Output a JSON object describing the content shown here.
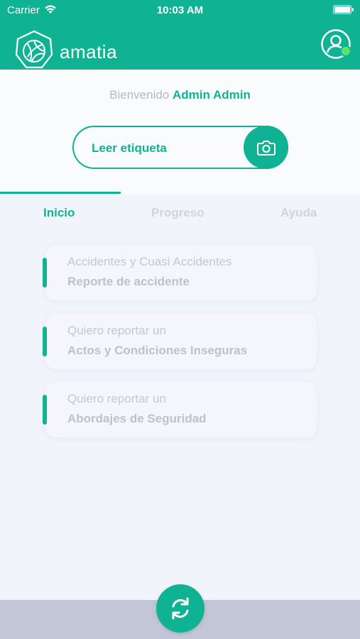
{
  "status_bar": {
    "carrier": "Carrier",
    "time": "10:03 AM"
  },
  "header": {
    "brand": "amatia"
  },
  "welcome": {
    "greeting": "Bienvenido",
    "user": "Admin Admin"
  },
  "scan": {
    "label": "Leer etiqueta"
  },
  "tabs": [
    {
      "label": "Inicio",
      "active": true
    },
    {
      "label": "Progreso",
      "active": false
    },
    {
      "label": "Ayuda",
      "active": false
    }
  ],
  "cards": [
    {
      "line1": "Accidentes y Cuasi Accidentes",
      "line2": "Reporte de accidente"
    },
    {
      "line1": "Quiero reportar un",
      "line2": "Actos y Condiciones Inseguras"
    },
    {
      "line1": "Quiero reportar un",
      "line2": "Abordajes de Seguridad"
    }
  ],
  "icons": {
    "logo": "amatia-logo-icon",
    "profile": "user-circle-icon",
    "camera": "camera-icon",
    "sync": "sync-icon",
    "wifi": "wifi-icon",
    "battery": "battery-icon"
  },
  "colors": {
    "accent": "#0fb394",
    "online": "#5be36e",
    "bottom_bar": "#c2c6d6"
  }
}
